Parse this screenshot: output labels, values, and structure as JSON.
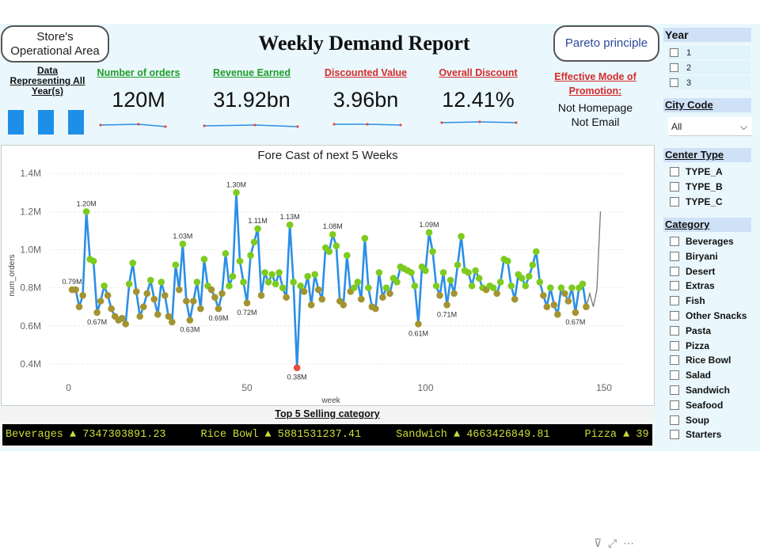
{
  "header": {
    "store_pill": "Store's\nOperational Area",
    "title": "Weekly Demand Report",
    "pareto_pill": "Pareto principle",
    "data_rep": "Data Representing All Year(s)"
  },
  "kpis": [
    {
      "title": "Number of orders",
      "value": "120M",
      "title_color": "#1f9d2a"
    },
    {
      "title": "Revenue Earned",
      "value": "31.92bn",
      "title_color": "#1f9d2a"
    },
    {
      "title": "Discounted Value",
      "value": "3.96bn",
      "title_color": "#d52b2b"
    },
    {
      "title": "Overall Discount",
      "value": "12.41%",
      "title_color": "#d52b2b"
    }
  ],
  "promotion": {
    "title": "Effective Mode of Promotion:",
    "line1": "Not Homepage",
    "line2": "Not Email"
  },
  "chart_data": {
    "type": "line",
    "title": "Fore Cast of next 5 Weeks",
    "xlabel": "week",
    "ylabel": "num_orders",
    "xlim": [
      -5,
      152
    ],
    "ylim": [
      0.3,
      1.43
    ],
    "x_ticks": [
      0,
      50,
      100,
      150
    ],
    "y_ticks": [
      0.4,
      0.6,
      0.8,
      1.0,
      1.2,
      1.4
    ],
    "y_tick_labels": [
      "0.4M",
      "0.6M",
      "0.8M",
      "1.0M",
      "1.2M",
      "1.4M"
    ],
    "x": [
      1,
      2,
      3,
      4,
      5,
      6,
      7,
      8,
      9,
      10,
      11,
      12,
      13,
      14,
      15,
      16,
      17,
      18,
      19,
      20,
      21,
      22,
      23,
      24,
      25,
      26,
      27,
      28,
      29,
      30,
      31,
      32,
      33,
      34,
      35,
      36,
      37,
      38,
      39,
      40,
      41,
      42,
      43,
      44,
      45,
      46,
      47,
      48,
      49,
      50,
      51,
      52,
      53,
      54,
      55,
      56,
      57,
      58,
      59,
      60,
      61,
      62,
      63,
      64,
      65,
      66,
      67,
      68,
      69,
      70,
      71,
      72,
      73,
      74,
      75,
      76,
      77,
      78,
      79,
      80,
      81,
      82,
      83,
      84,
      85,
      86,
      87,
      88,
      89,
      90,
      91,
      92,
      93,
      94,
      95,
      96,
      97,
      98,
      99,
      100,
      101,
      102,
      103,
      104,
      105,
      106,
      107,
      108,
      109,
      110,
      111,
      112,
      113,
      114,
      115,
      116,
      117,
      118,
      119,
      120,
      121,
      122,
      123,
      124,
      125,
      126,
      127,
      128,
      129,
      130,
      131,
      132,
      133,
      134,
      135,
      136,
      137,
      138,
      139,
      140,
      141,
      142,
      143,
      144,
      145
    ],
    "values": [
      0.79,
      0.79,
      0.7,
      0.76,
      1.2,
      0.95,
      0.94,
      0.67,
      0.73,
      0.81,
      0.76,
      0.69,
      0.65,
      0.63,
      0.64,
      0.61,
      0.82,
      0.93,
      0.78,
      0.65,
      0.7,
      0.77,
      0.84,
      0.74,
      0.66,
      0.83,
      0.76,
      0.65,
      0.62,
      0.92,
      0.79,
      1.03,
      0.73,
      0.63,
      0.73,
      0.83,
      0.69,
      0.95,
      0.81,
      0.79,
      0.75,
      0.69,
      0.77,
      0.98,
      0.81,
      0.86,
      1.3,
      0.94,
      0.83,
      0.72,
      0.97,
      1.04,
      1.11,
      0.76,
      0.88,
      0.83,
      0.87,
      0.82,
      0.88,
      0.8,
      0.75,
      1.13,
      0.83,
      0.38,
      0.81,
      0.78,
      0.86,
      0.71,
      0.87,
      0.79,
      0.74,
      1.01,
      0.99,
      1.08,
      1.02,
      0.73,
      0.71,
      0.97,
      0.78,
      0.8,
      0.83,
      0.74,
      1.06,
      0.8,
      0.7,
      0.69,
      0.88,
      0.75,
      0.8,
      0.77,
      0.85,
      0.83,
      0.91,
      0.9,
      0.89,
      0.88,
      0.81,
      0.61,
      0.91,
      0.89,
      1.09,
      0.99,
      0.81,
      0.76,
      0.88,
      0.71,
      0.84,
      0.77,
      0.92,
      1.07,
      0.89,
      0.88,
      0.81,
      0.89,
      0.85,
      0.8,
      0.79,
      0.81,
      0.8,
      0.77,
      0.83,
      0.95,
      0.94,
      0.81,
      0.74,
      0.87,
      0.85,
      0.81,
      0.86,
      0.92,
      0.99,
      0.83,
      0.76,
      0.7,
      0.8,
      0.71,
      0.66,
      0.8,
      0.77,
      0.73,
      0.8,
      0.67,
      0.8,
      0.82,
      0.7
    ],
    "forecast_x": [
      145,
      146,
      147,
      148,
      149
    ],
    "forecast_values": [
      0.7,
      0.77,
      0.7,
      0.79,
      1.2
    ],
    "data_labels": [
      {
        "x": 1,
        "y": 0.79,
        "text": "0.79M",
        "pos": "above"
      },
      {
        "x": 5,
        "y": 1.2,
        "text": "1.20M",
        "pos": "above"
      },
      {
        "x": 8,
        "y": 0.67,
        "text": "0.67M",
        "pos": "below"
      },
      {
        "x": 32,
        "y": 1.03,
        "text": "1.03M",
        "pos": "above"
      },
      {
        "x": 34,
        "y": 0.63,
        "text": "0.63M",
        "pos": "below"
      },
      {
        "x": 42,
        "y": 0.69,
        "text": "0.69M",
        "pos": "below"
      },
      {
        "x": 47,
        "y": 1.3,
        "text": "1.30M",
        "pos": "above"
      },
      {
        "x": 50,
        "y": 0.72,
        "text": "0.72M",
        "pos": "below"
      },
      {
        "x": 53,
        "y": 1.11,
        "text": "1.11M",
        "pos": "above"
      },
      {
        "x": 62,
        "y": 1.13,
        "text": "1.13M",
        "pos": "above"
      },
      {
        "x": 64,
        "y": 0.38,
        "text": "0.38M",
        "pos": "below"
      },
      {
        "x": 74,
        "y": 1.08,
        "text": "1.08M",
        "pos": "above"
      },
      {
        "x": 98,
        "y": 0.61,
        "text": "0.61M",
        "pos": "below"
      },
      {
        "x": 101,
        "y": 1.09,
        "text": "1.09M",
        "pos": "above"
      },
      {
        "x": 106,
        "y": 0.71,
        "text": "0.71M",
        "pos": "below"
      },
      {
        "x": 142,
        "y": 0.67,
        "text": "0.67M",
        "pos": "below"
      }
    ],
    "grid": true,
    "colors": {
      "line": "#2b8fe6",
      "marker_high": "#7dcb1f",
      "marker_low": "#a39431",
      "marker_min": "#e84c3d",
      "forecast": "#777777"
    }
  },
  "ticker": {
    "title": "Top 5 Selling category",
    "items": [
      "Beverages ▲ 7347303891.23",
      "Rice Bowl ▲ 5881531237.41",
      "Sandwich ▲ 4663426849.81",
      "Pizza ▲ 39"
    ]
  },
  "sidebar": {
    "year_label": "Year",
    "years": [
      "1",
      "2",
      "3"
    ],
    "city_label": "City Code",
    "city_value": "All",
    "center_label": "Center Type",
    "centers": [
      "TYPE_A",
      "TYPE_B",
      "TYPE_C"
    ],
    "category_label": "Category",
    "categories": [
      "Beverages",
      "Biryani",
      "Desert",
      "Extras",
      "Fish",
      "Other Snacks",
      "Pasta",
      "Pizza",
      "Rice Bowl",
      "Salad",
      "Sandwich",
      "Seafood",
      "Soup",
      "Starters"
    ]
  }
}
